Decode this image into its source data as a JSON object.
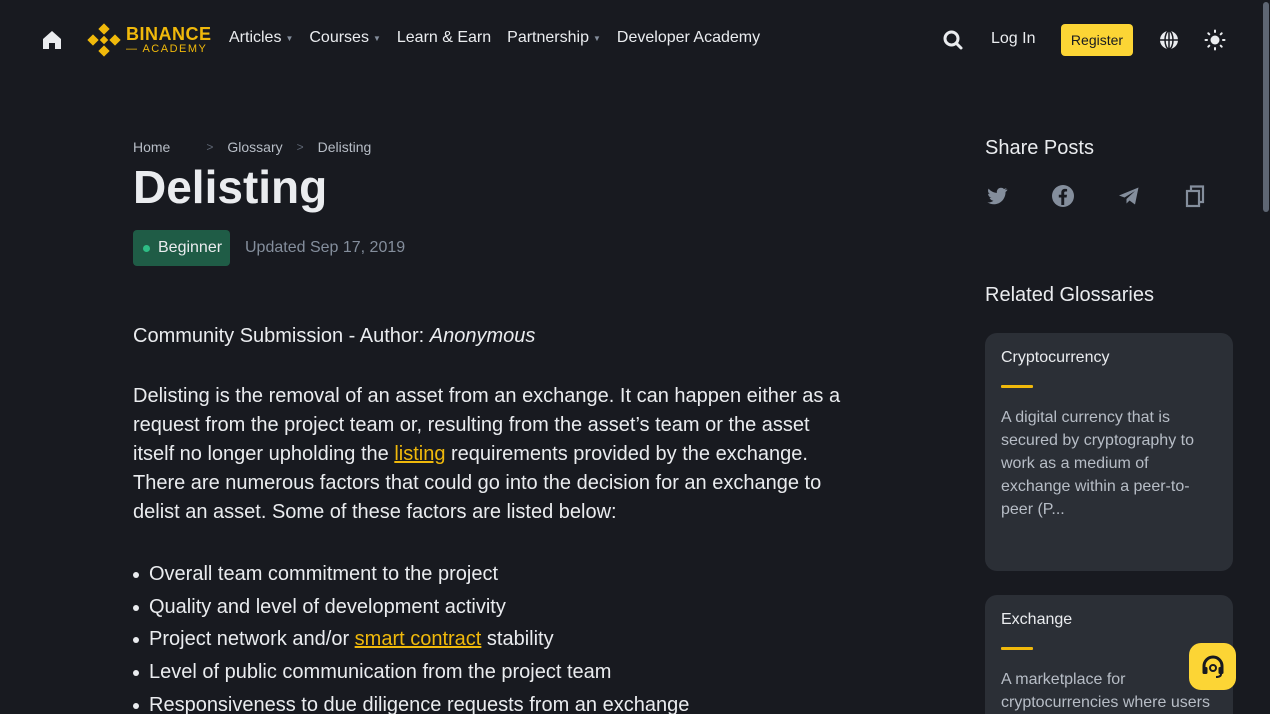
{
  "header": {
    "logo": {
      "line1": "BINANCE",
      "line2": "ACADEMY"
    },
    "nav": [
      {
        "label": "Articles",
        "caret": true
      },
      {
        "label": "Courses",
        "caret": true
      },
      {
        "label": "Learn & Earn",
        "caret": false
      },
      {
        "label": "Partnership",
        "caret": true
      },
      {
        "label": "Developer Academy",
        "caret": false
      }
    ],
    "login": "Log In",
    "register": "Register"
  },
  "breadcrumb": {
    "home": "Home",
    "section": "Glossary",
    "current": "Delisting"
  },
  "article": {
    "title": "Delisting",
    "level": "Beginner",
    "updated": "Updated Sep 17, 2019",
    "author_prefix": "Community Submission - Author: ",
    "author_name": "Anonymous",
    "para_part1": "Delisting is the removal of an asset from an exchange. It can happen either as a request from the project team or, resulting from the asset’s team or the asset itself no longer upholding the ",
    "para_link": "listing",
    "para_part2": " requirements provided by the exchange. There are numerous factors that could go into the decision for an exchange to delist an asset. Some of these factors are listed below:",
    "bullets": {
      "b1": "Overall team commitment to the project",
      "b2": "Quality and level of development activity",
      "b3_pre": "Project network and/or ",
      "b3_link": "smart contract",
      "b3_post": " stability",
      "b4": "Level of public communication from the project team",
      "b5": "Responsiveness to due diligence requests from an exchange"
    }
  },
  "sidebar": {
    "share_title": "Share Posts",
    "related_title": "Related Glossaries",
    "cards": [
      {
        "title": "Cryptocurrency",
        "text": "A digital currency that is secured by cryptography to work as a medium of exchange within a peer-to-peer (P..."
      },
      {
        "title": "Exchange",
        "text": "A marketplace for cryptocurrencies where users"
      }
    ]
  },
  "colors": {
    "background": "#181a20",
    "accent": "#f0b90b",
    "register_bg": "#fcd535",
    "badge_bg": "#1f5c46",
    "card_bg": "#2b2f36"
  },
  "icons": [
    "home-icon",
    "binance-logo-icon",
    "search-icon",
    "globe-icon",
    "theme-icon",
    "twitter-icon",
    "facebook-icon",
    "telegram-icon",
    "copy-icon",
    "support-icon"
  ]
}
